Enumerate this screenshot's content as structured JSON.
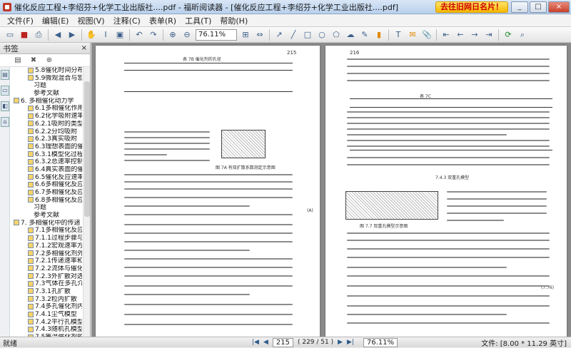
{
  "window": {
    "title": "催化反应工程+李绍芬+化学工业出版社....pdf - 福昕阅读器 - [催化反应工程+李绍芬+化学工业出版社....pdf]",
    "ad_text": "去往旧网日名片！",
    "minimize": "_",
    "maximize": "□",
    "close": "×"
  },
  "menu": [
    {
      "label": "文件(F)"
    },
    {
      "label": "编辑(E)"
    },
    {
      "label": "视图(V)"
    },
    {
      "label": "注释(C)"
    },
    {
      "label": "表单(R)"
    },
    {
      "label": "工具(T)"
    },
    {
      "label": "帮助(H)"
    }
  ],
  "toolbar": {
    "zoom_value": "76.11%"
  },
  "sidebar": {
    "title": "书签",
    "close": "×",
    "items": [
      {
        "level": "l2",
        "text": "5.8催化时间分布与"
      },
      {
        "level": "l2",
        "text": "5.9微观混合与宏观"
      },
      {
        "level": "l3",
        "text": "习题"
      },
      {
        "level": "l3",
        "text": "参考文献"
      },
      {
        "level": "l1",
        "text": "6. 多相催化动力学"
      },
      {
        "level": "l2",
        "text": "6.1多相催化作用的"
      },
      {
        "level": "l2",
        "text": "6.2化学吸附速率"
      },
      {
        "level": "l2",
        "text": "6.2.1吸附的类型"
      },
      {
        "level": "l2",
        "text": "6.2.2分均吸附"
      },
      {
        "level": "l2",
        "text": "6.2.3真实吸附"
      },
      {
        "level": "l2",
        "text": "6.3理想表面的催化"
      },
      {
        "level": "l2",
        "text": "6.3.1模型化过程"
      },
      {
        "level": "l2",
        "text": "6.3.2总速率控制"
      },
      {
        "level": "l2",
        "text": "6.4真实表面的催化"
      },
      {
        "level": "l2",
        "text": "6.5催化反应速率方"
      },
      {
        "level": "l2",
        "text": "6.6多相催化反应动"
      },
      {
        "level": "l2",
        "text": "6.7多相催化反应动"
      },
      {
        "level": "l2",
        "text": "6.8多相催化反应动"
      },
      {
        "level": "l3",
        "text": "习题"
      },
      {
        "level": "l3",
        "text": "参考文献"
      },
      {
        "level": "l1",
        "text": "7. 多相催化中的传递"
      },
      {
        "level": "l2",
        "text": "7.1多相催化反应过"
      },
      {
        "level": "l2",
        "text": "7.1.1过程步骤与速"
      },
      {
        "level": "l2",
        "text": "7.1.2宏观速率方程"
      },
      {
        "level": "l2",
        "text": "7.2多相催化剂外"
      },
      {
        "level": "l2",
        "text": "7.2.1传递速率和"
      },
      {
        "level": "l2",
        "text": "7.2.2流体与催化剂"
      },
      {
        "level": "l2",
        "text": "7.2.3外扩散对选"
      },
      {
        "level": "l2",
        "text": "7.3气体在多孔介质"
      },
      {
        "level": "l2",
        "text": "7.3.1孔扩散"
      },
      {
        "level": "l2",
        "text": "7.3.2粒内扩散"
      },
      {
        "level": "l2",
        "text": "7.4多孔催化剂内的"
      },
      {
        "level": "l2",
        "text": "7.4.1尘气模型"
      },
      {
        "level": "l2",
        "text": "7.4.2平行孔模型"
      },
      {
        "level": "l2",
        "text": "7.4.3随机孔模型"
      },
      {
        "level": "l2",
        "text": "7.5等温催化剂的有"
      },
      {
        "level": "l2",
        "text": "7.5.1一级不可逆"
      }
    ]
  },
  "pages": {
    "left_number": "215",
    "right_number": "216",
    "left_table_title": "表 7B  催化剂的孔径",
    "right_table_title": "表 7C",
    "right_section": "7.4.3  双重孔模型",
    "left_eq_no": "(A)",
    "right_eq_no": "(7.76)",
    "fig_left_caption": "图 7A  有效扩散系数测定示意图",
    "fig_right_caption": "图 7.7  双重孔模型示意图"
  },
  "status": {
    "left": "就绪",
    "current_page": "215",
    "page_info": "( 229 / 51 )",
    "zoom": "76.11%",
    "file_info": "文件: [8.00 * 11.29 英寸]"
  }
}
